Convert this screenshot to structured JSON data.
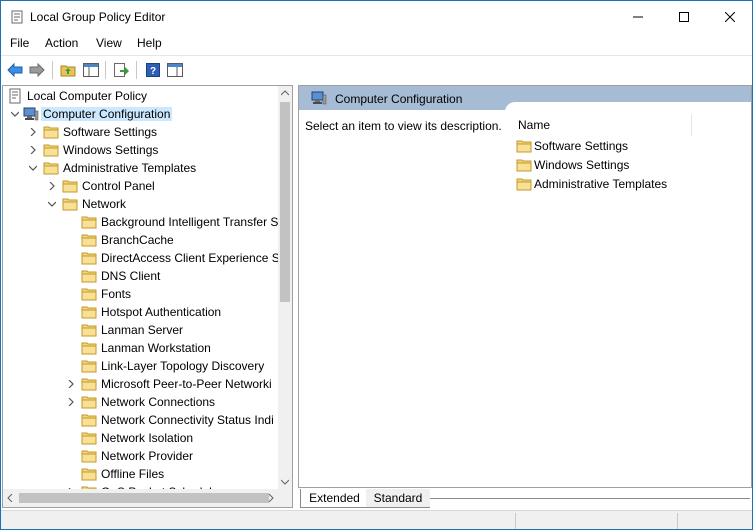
{
  "window": {
    "title": "Local Group Policy Editor",
    "accent": "#1f6fb5"
  },
  "menu": {
    "items": [
      {
        "label": "File"
      },
      {
        "label": "Action"
      },
      {
        "label": "View"
      },
      {
        "label": "Help"
      }
    ]
  },
  "toolbar": {
    "buttons": [
      {
        "icon": "back-arrow-icon"
      },
      {
        "icon": "forward-arrow-icon"
      },
      {
        "icon": "up-folder-icon"
      },
      {
        "icon": "show-hide-console-tree-icon"
      },
      {
        "icon": "export-list-icon"
      },
      {
        "icon": "help-icon"
      },
      {
        "icon": "show-hide-action-pane-icon"
      }
    ]
  },
  "tree": {
    "items": [
      {
        "label": "Local Computer Policy",
        "icon": "policy-icon",
        "level": 0,
        "expander": "none",
        "selected": false
      },
      {
        "label": "Computer Configuration",
        "icon": "computer-icon",
        "level": 0,
        "expander": "expanded",
        "selected": true
      },
      {
        "label": "Software Settings",
        "icon": "folder-icon",
        "level": 1,
        "expander": "collapsed",
        "selected": false
      },
      {
        "label": "Windows Settings",
        "icon": "folder-icon",
        "level": 1,
        "expander": "collapsed",
        "selected": false
      },
      {
        "label": "Administrative Templates",
        "icon": "folder-icon",
        "level": 1,
        "expander": "expanded",
        "selected": false
      },
      {
        "label": "Control Panel",
        "icon": "folder-icon",
        "level": 2,
        "expander": "collapsed",
        "selected": false
      },
      {
        "label": "Network",
        "icon": "folder-icon",
        "level": 2,
        "expander": "expanded",
        "selected": false
      },
      {
        "label": "Background Intelligent Transfer S",
        "icon": "folder-icon",
        "level": 3,
        "expander": "none",
        "selected": false
      },
      {
        "label": "BranchCache",
        "icon": "folder-icon",
        "level": 3,
        "expander": "none",
        "selected": false
      },
      {
        "label": "DirectAccess Client Experience Se",
        "icon": "folder-icon",
        "level": 3,
        "expander": "none",
        "selected": false
      },
      {
        "label": "DNS Client",
        "icon": "folder-icon",
        "level": 3,
        "expander": "none",
        "selected": false
      },
      {
        "label": "Fonts",
        "icon": "folder-icon",
        "level": 3,
        "expander": "none",
        "selected": false
      },
      {
        "label": "Hotspot Authentication",
        "icon": "folder-icon",
        "level": 3,
        "expander": "none",
        "selected": false
      },
      {
        "label": "Lanman Server",
        "icon": "folder-icon",
        "level": 3,
        "expander": "none",
        "selected": false
      },
      {
        "label": "Lanman Workstation",
        "icon": "folder-icon",
        "level": 3,
        "expander": "none",
        "selected": false
      },
      {
        "label": "Link-Layer Topology Discovery",
        "icon": "folder-icon",
        "level": 3,
        "expander": "none",
        "selected": false
      },
      {
        "label": "Microsoft Peer-to-Peer Networki",
        "icon": "folder-icon",
        "level": 3,
        "expander": "collapsed",
        "selected": false
      },
      {
        "label": "Network Connections",
        "icon": "folder-icon",
        "level": 3,
        "expander": "collapsed",
        "selected": false
      },
      {
        "label": "Network Connectivity Status Indi",
        "icon": "folder-icon",
        "level": 3,
        "expander": "none",
        "selected": false
      },
      {
        "label": "Network Isolation",
        "icon": "folder-icon",
        "level": 3,
        "expander": "none",
        "selected": false
      },
      {
        "label": "Network Provider",
        "icon": "folder-icon",
        "level": 3,
        "expander": "none",
        "selected": false
      },
      {
        "label": "Offline Files",
        "icon": "folder-icon",
        "level": 3,
        "expander": "none",
        "selected": false
      },
      {
        "label": "QoS Packet Scheduler",
        "icon": "folder-icon",
        "level": 3,
        "expander": "collapsed",
        "selected": false
      }
    ]
  },
  "right_pane": {
    "header_title": "Computer Configuration",
    "description": "Select an item to view its description.",
    "column_name": "Name",
    "items": [
      {
        "label": "Software Settings",
        "icon": "folder-icon"
      },
      {
        "label": "Windows Settings",
        "icon": "folder-icon"
      },
      {
        "label": "Administrative Templates",
        "icon": "folder-icon"
      }
    ]
  },
  "tabs": {
    "extended": "Extended",
    "standard": "Standard"
  }
}
